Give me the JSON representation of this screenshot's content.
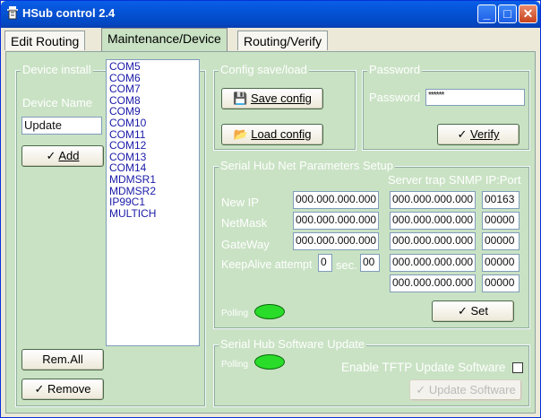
{
  "window": {
    "title": "HSub control 2.4",
    "minimize_glyph": "_",
    "maximize_glyph": "□",
    "close_glyph": "✕"
  },
  "tabs": [
    {
      "label": "Edit Routing",
      "active": false
    },
    {
      "label": "Maintenance/Device",
      "active": true
    },
    {
      "label": "Routing/Verify",
      "active": false
    }
  ],
  "device_install": {
    "legend": "Device install",
    "device_name_label": "Device Name",
    "device_name_value": "Update",
    "add_button": "Add",
    "rem_all_button": "Rem.All",
    "remove_button": "Remove",
    "devices": [
      "COM5",
      "COM6",
      "COM7",
      "COM8",
      "COM9",
      "COM10",
      "COM11",
      "COM12",
      "COM13",
      "COM14",
      "MDMSR1",
      "MDMSR2",
      "IP99C1",
      "MULTICH"
    ]
  },
  "config": {
    "legend": "Config save/load",
    "save_button": "Save config",
    "load_button": "Load config"
  },
  "password": {
    "legend": "Password",
    "label": "Password",
    "value": "******",
    "verify_button": "Verify"
  },
  "net_setup": {
    "legend": "Serial Hub Net Parameters Setup",
    "server_trap_header": "Server trap SNMP IP:Port",
    "rows": [
      {
        "label": "New IP",
        "ip": "000.000.000.000",
        "trap_ip": "000.000.000.000",
        "port": "00163"
      },
      {
        "label": "NetMask",
        "ip": "000.000.000.000",
        "trap_ip": "000.000.000.000",
        "port": "00000"
      },
      {
        "label": "GateWay",
        "ip": "000.000.000.000",
        "trap_ip": "000.000.000.000",
        "port": "00000"
      }
    ],
    "keepalive_label": "KeepAlive attempt",
    "keepalive_value": "0",
    "sec_label": "sec.",
    "sec_value": "00",
    "keepalive_trap_ip": "000.000.000.000",
    "keepalive_port": "00000",
    "extra_trap_ip": "000.000.000.000",
    "extra_port": "00000",
    "polling_label": "Polling",
    "set_button": "Set"
  },
  "software_update": {
    "legend": "Serial Hub Software Update",
    "polling_label": "Polling",
    "tftp_label": "Enable TFTP Update Software",
    "tftp_checked": false,
    "update_button": "Update Software"
  },
  "colors": {
    "panel_bg": "#c9e2c4",
    "led_green": "#2adc2a",
    "list_text": "#1a1aa8",
    "title_blue": "#0453d6"
  }
}
